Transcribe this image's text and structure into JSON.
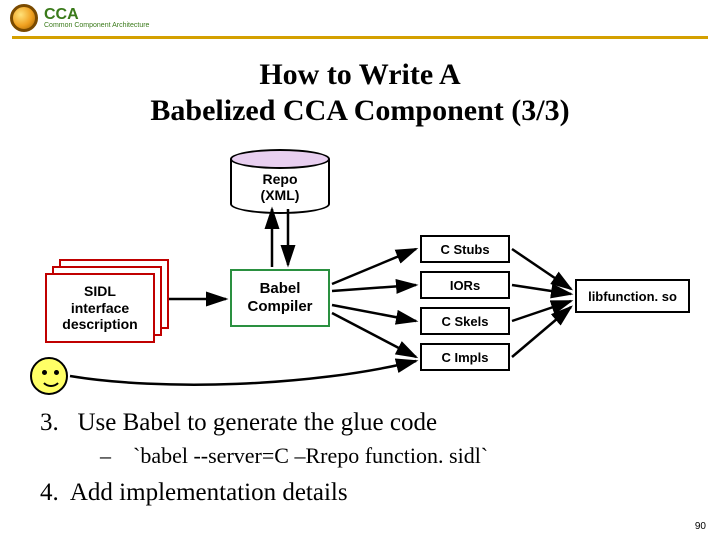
{
  "header": {
    "abbr": "CCA",
    "subtitle": "Common Component Architecture"
  },
  "title": {
    "line1": "How to Write A",
    "line2": "Babelized CCA Component (3/3)"
  },
  "diagram": {
    "repo": {
      "line1": "Repo",
      "line2": "(XML)"
    },
    "sidl": {
      "line1": "SIDL",
      "line2": "interface",
      "line3": "description"
    },
    "compiler": {
      "line1": "Babel",
      "line2": "Compiler"
    },
    "outputs": {
      "stubs": "C Stubs",
      "iors": "IORs",
      "skels": "C Skels",
      "impls": "C Impls"
    },
    "lib": "libfunction. so",
    "smiley_name": "smiley-face"
  },
  "bullets": {
    "item3_num": "3.",
    "item3": "Use Babel to generate the glue code",
    "item3_sub_dash": "–",
    "item3_sub": "`babel --server=C –Rrepo function. sidl`",
    "item4_num": "4.",
    "item4": " Add implementation details"
  },
  "slide_number": "90"
}
